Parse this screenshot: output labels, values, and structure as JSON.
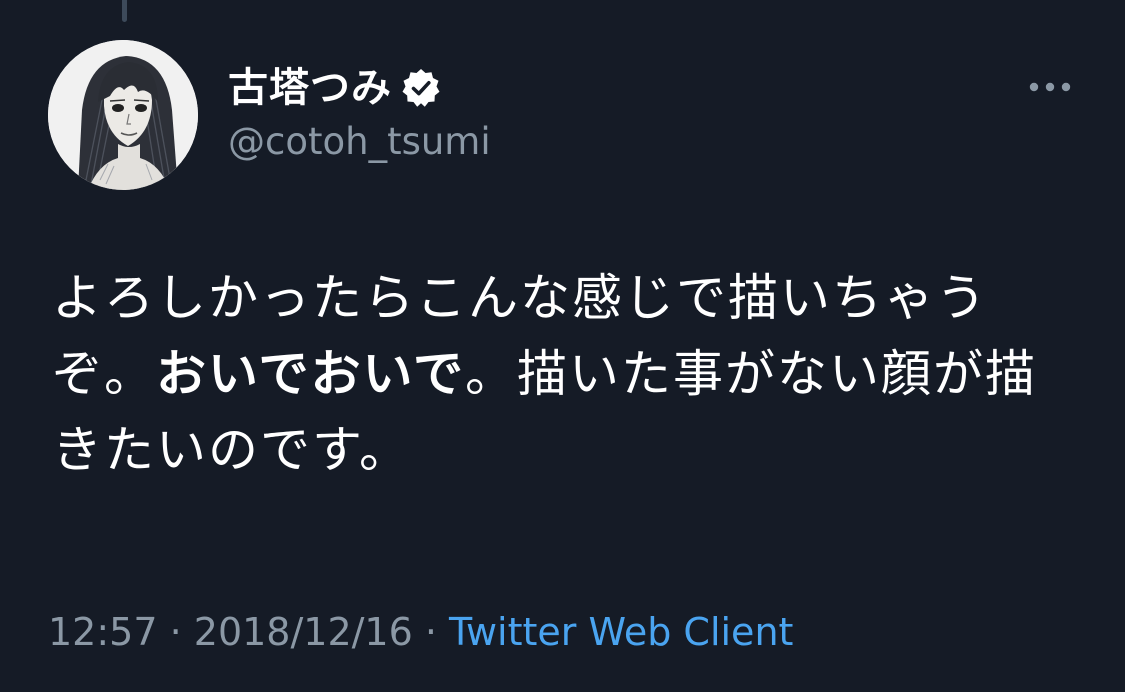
{
  "tweet": {
    "author": {
      "display_name": "古塔つみ",
      "handle": "@cotoh_tsumi",
      "verified": true
    },
    "text": {
      "part1": "よろしかったらこんな感じで描いちゃうぞ。",
      "bold": "おいでおいで",
      "part2": "。描いた事がない顔が描きたいのです。"
    },
    "meta": {
      "time": "12:57",
      "separator1": " · ",
      "date": "2018/12/16",
      "separator2": " · ",
      "client": "Twitter Web Client"
    }
  },
  "icons": {
    "verified": "verified-badge-icon",
    "more": "more-options-icon"
  },
  "colors": {
    "background": "#151b26",
    "text": "#ffffff",
    "secondary": "#8b98a5",
    "link": "#4aa4f0"
  }
}
